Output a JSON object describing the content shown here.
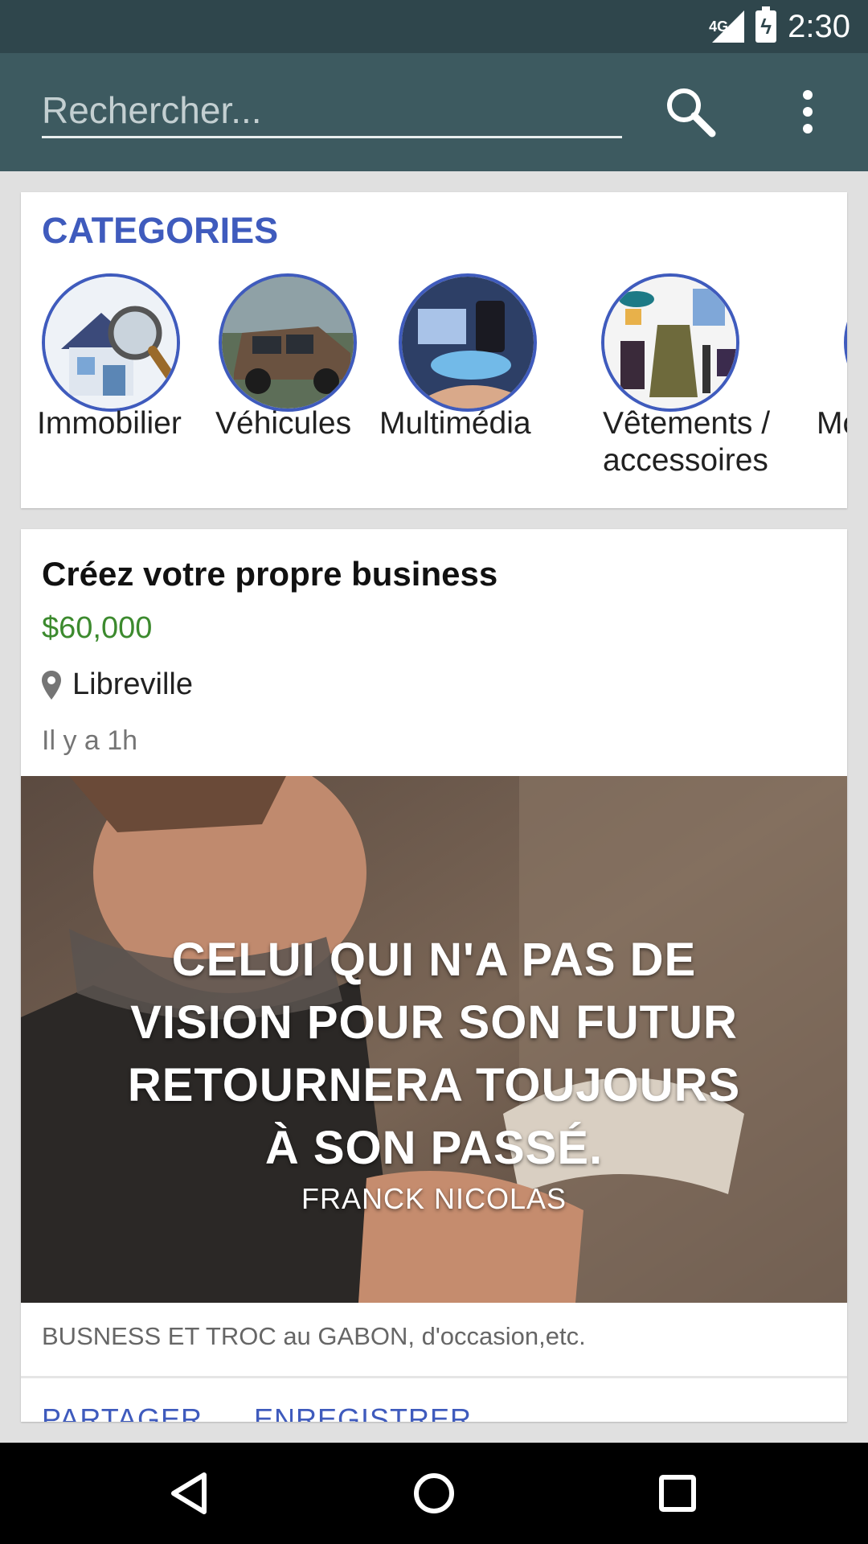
{
  "status_bar": {
    "network": "4G",
    "time": "2:30"
  },
  "toolbar": {
    "search_placeholder": "Rechercher...",
    "search_icon": "search-icon",
    "menu_icon": "more-vert-icon"
  },
  "categories": {
    "title": "CATEGORIES",
    "items": [
      {
        "label": "Immobilier"
      },
      {
        "label": "Véhicules"
      },
      {
        "label": "Multimédia"
      },
      {
        "label_line1": "Vêtements /",
        "label_line2": "accessoires"
      },
      {
        "label": "Mode"
      }
    ]
  },
  "listing": {
    "title": "Créez votre propre business",
    "price": "$60,000",
    "location": "Libreville",
    "time_ago": "Il y a 1h",
    "image_quote_lines": [
      "CELUI QUI N'A PAS DE",
      "VISION POUR SON FUTUR",
      "RETOURNERA TOUJOURS",
      "À SON PASSÉ."
    ],
    "image_quote_author": "FRANCK NICOLAS",
    "description": "BUSNESS ET TROC au GABON, d'occasion,etc.",
    "share_label": "PARTAGER",
    "save_label": "ENREGISTRER"
  },
  "colors": {
    "status_bar": "#2f464c",
    "toolbar": "#3d5a60",
    "accent": "#3f5bbd",
    "price": "#3c8a2e"
  }
}
